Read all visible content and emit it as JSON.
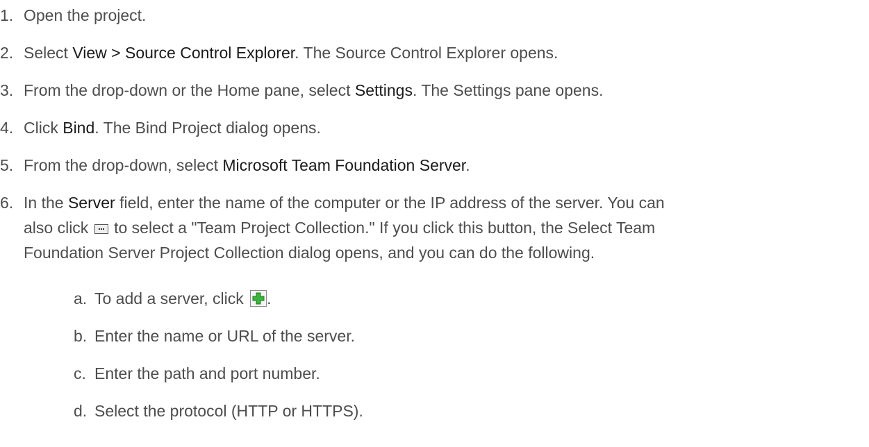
{
  "steps": [
    {
      "num": "1.",
      "parts": [
        "Open the project."
      ]
    },
    {
      "num": "2.",
      "pre": "Select ",
      "bold": "View > Source Control Explorer",
      "post": ". The Source Control Explorer opens."
    },
    {
      "num": "3.",
      "pre": "From the drop-down or the Home pane, select ",
      "bold": "Settings",
      "post": ". The Settings pane opens."
    },
    {
      "num": "4.",
      "pre": "Click ",
      "bold": "Bind",
      "post": ". The Bind Project dialog opens."
    },
    {
      "num": "5.",
      "pre": "From the drop-down, select ",
      "bold": "Microsoft Team Foundation Server",
      "post": "."
    },
    {
      "num": "6.",
      "pre": "In the ",
      "bold": "Server",
      "line1_post": " field, enter the name of the computer or the IP address of the server. You can",
      "line2_pre": "also click ",
      "line2_post": " to select a \"Team Project Collection.\" If you click this button, the Select Team",
      "line3": "Foundation Server Project Collection dialog opens, and you can do the following."
    }
  ],
  "substeps": [
    {
      "num": "a.",
      "text": "To add a server, click ",
      "post": "."
    },
    {
      "num": "b.",
      "text": "Enter the name or URL of the server."
    },
    {
      "num": "c.",
      "text": "Enter the path and port number."
    },
    {
      "num": "d.",
      "text": "Select the protocol (HTTP or HTTPS)."
    }
  ],
  "icons": {
    "browse_button": "ellipsis-button-icon",
    "add_server": "green-plus-icon",
    "plus_color": "#3cb33c"
  }
}
